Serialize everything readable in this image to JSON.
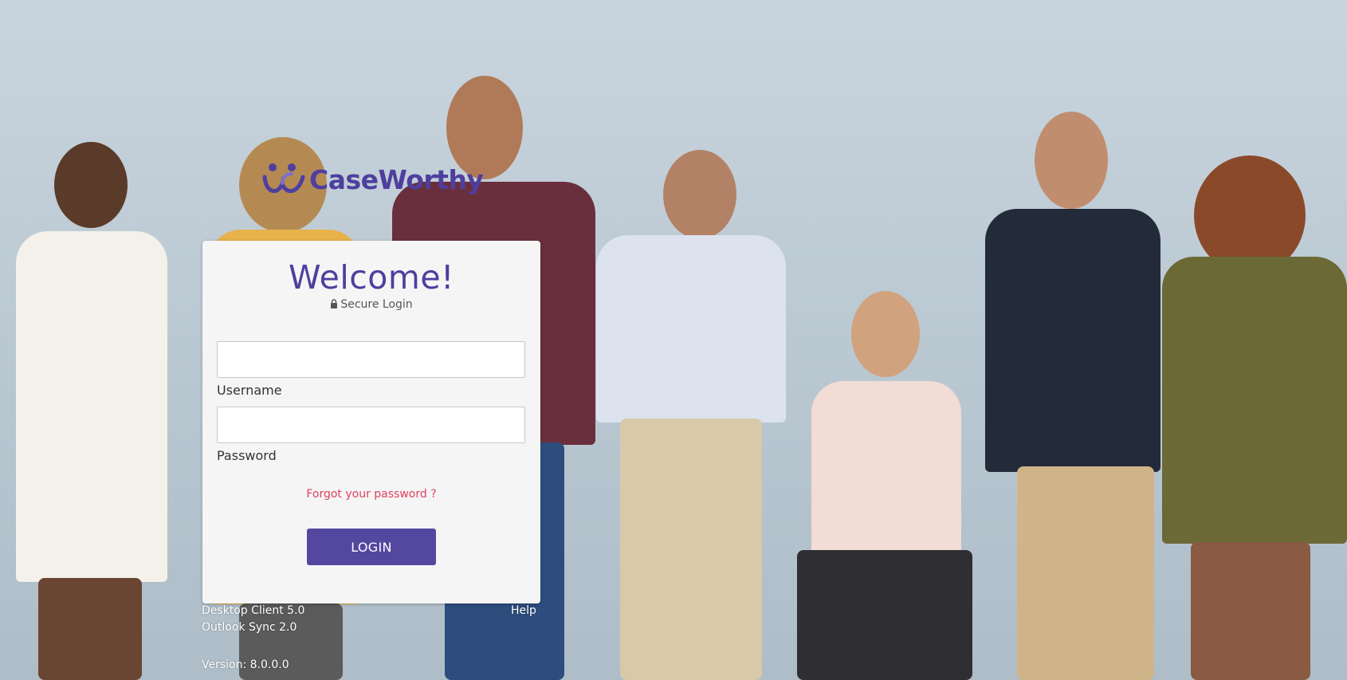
{
  "brand": {
    "name": "CaseWorthy",
    "color": "#4e3f9e"
  },
  "login": {
    "title": "Welcome!",
    "subtitle": "Secure Login",
    "subtitle_icon": "lock-icon",
    "username": {
      "label": "Username",
      "value": "",
      "placeholder": ""
    },
    "password": {
      "label": "Password",
      "value": "",
      "placeholder": ""
    },
    "forgot_link": "Forgot your password ?",
    "submit_label": "LOGIN",
    "accent_color": "#54479f",
    "link_color": "#e0405e"
  },
  "footer": {
    "desktop_client": "Desktop Client 5.0",
    "outlook_sync": "Outlook Sync 2.0",
    "help": "Help",
    "version": "Version: 8.0.0.0"
  }
}
